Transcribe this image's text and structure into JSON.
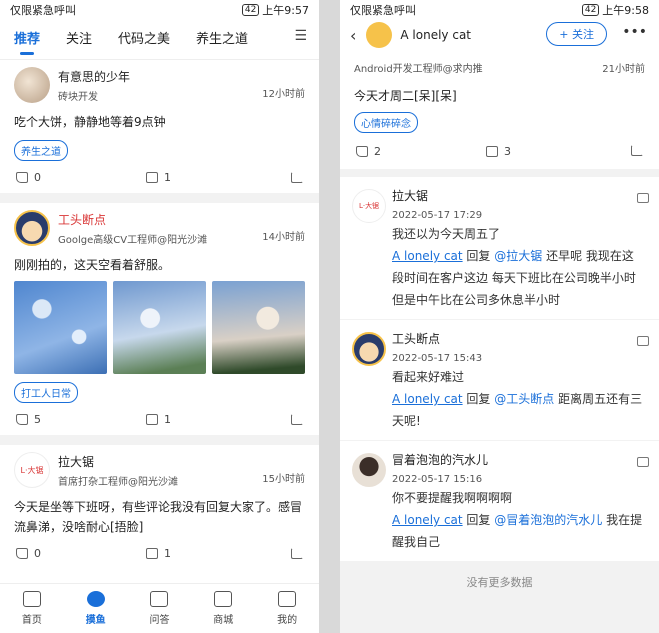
{
  "left": {
    "status": {
      "carrier": "仅限紧急呼叫",
      "battery": "42",
      "time": "上午9:57"
    },
    "tabs": [
      "推荐",
      "关注",
      "代码之美",
      "养生之道"
    ],
    "posts": [
      {
        "author": "有意思的少年",
        "subtitle": "砖块开发",
        "time": "12小时前",
        "text": "吃个大饼，静静地等着9点钟",
        "tag": "养生之道",
        "likes": "0",
        "comments": "1"
      },
      {
        "author": "工头断点",
        "subtitle": "Goolge高级CV工程师@阳光沙滩",
        "time": "14小时前",
        "text": "刚刚拍的，这天空看着舒服。",
        "tag": "打工人日常",
        "likes": "5",
        "comments": "1"
      },
      {
        "author": "拉大锯",
        "subtitle": "首席打杂工程师@阳光沙滩",
        "time": "15小时前",
        "text": "今天是坐等下班呀，有些评论我没有回复大家了。感冒流鼻涕，没啥耐心[捂脸]",
        "likes": "0",
        "comments": "1"
      }
    ],
    "tabbar": [
      "首页",
      "摸鱼",
      "问答",
      "商城",
      "我的"
    ]
  },
  "right": {
    "status": {
      "carrier": "仅限紧急呼叫",
      "battery": "42",
      "time": "上午9:58"
    },
    "header": {
      "name": "A lonely cat",
      "follow": "+ 关注"
    },
    "detail": {
      "subtitle": "Android开发工程师@求内推",
      "time": "21小时前",
      "text": "今天才周二[呆][呆]",
      "tag": "心情碎碎念",
      "likes": "2",
      "comments": "3"
    },
    "comments": [
      {
        "name": "拉大锯",
        "date": "2022-05-17 17:29",
        "text": "我还以为今天周五了",
        "reply_user": "A lonely cat",
        "reply_word": "回复",
        "reply_to": "@拉大锯",
        "reply_text": "还早呢 我现在这段时间在客户这边 每天下班比在公司晚半小时 但是中午比在公司多休息半小时"
      },
      {
        "name": "工头断点",
        "date": "2022-05-17 15:43",
        "text": "看起来好难过",
        "reply_user": "A lonely cat",
        "reply_word": "回复",
        "reply_to": "@工头断点",
        "reply_text": "距离周五还有三天呢!"
      },
      {
        "name": "冒着泡泡的汽水儿",
        "date": "2022-05-17 15:16",
        "text": "你不要提醒我啊啊啊啊",
        "reply_user": "A lonely cat",
        "reply_word": "回复",
        "reply_to": "@冒着泡泡的汽水儿",
        "reply_text": "我在提醒我自己"
      }
    ],
    "no_more": "没有更多数据"
  }
}
